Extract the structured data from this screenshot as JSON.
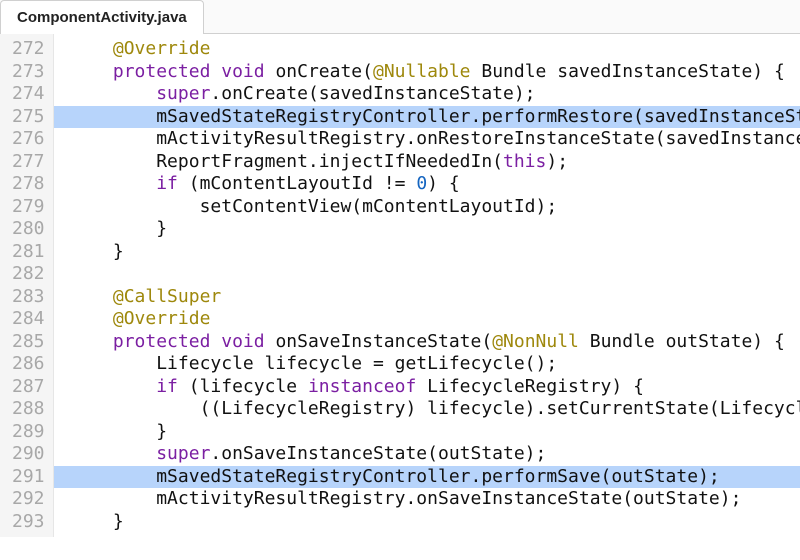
{
  "tab": {
    "title": "ComponentActivity.java"
  },
  "lines": [
    {
      "n": 272,
      "hl": false,
      "ind": 1,
      "tokens": [
        {
          "t": "@Override",
          "c": "ann"
        }
      ]
    },
    {
      "n": 273,
      "hl": false,
      "ind": 1,
      "tokens": [
        {
          "t": "protected ",
          "c": "kw"
        },
        {
          "t": "void ",
          "c": "kw"
        },
        {
          "t": "onCreate(",
          "c": "plain"
        },
        {
          "t": "@Nullable",
          "c": "ann"
        },
        {
          "t": " Bundle savedInstanceState) {",
          "c": "plain"
        }
      ]
    },
    {
      "n": 274,
      "hl": false,
      "ind": 2,
      "tokens": [
        {
          "t": "super",
          "c": "kw"
        },
        {
          "t": ".onCreate(savedInstanceState);",
          "c": "plain"
        }
      ]
    },
    {
      "n": 275,
      "hl": true,
      "ind": 2,
      "tokens": [
        {
          "t": "mSavedStateRegistryController.performRestore(savedInstanceState);",
          "c": "plain"
        }
      ]
    },
    {
      "n": 276,
      "hl": false,
      "ind": 2,
      "tokens": [
        {
          "t": "mActivityResultRegistry.onRestoreInstanceState(savedInstanceState);",
          "c": "plain"
        }
      ]
    },
    {
      "n": 277,
      "hl": false,
      "ind": 2,
      "tokens": [
        {
          "t": "ReportFragment.injectIfNeededIn(",
          "c": "plain"
        },
        {
          "t": "this",
          "c": "this"
        },
        {
          "t": ");",
          "c": "plain"
        }
      ]
    },
    {
      "n": 278,
      "hl": false,
      "ind": 2,
      "tokens": [
        {
          "t": "if",
          "c": "kw"
        },
        {
          "t": " (mContentLayoutId != ",
          "c": "plain"
        },
        {
          "t": "0",
          "c": "num"
        },
        {
          "t": ") {",
          "c": "plain"
        }
      ]
    },
    {
      "n": 279,
      "hl": false,
      "ind": 3,
      "tokens": [
        {
          "t": "setContentView(mContentLayoutId);",
          "c": "plain"
        }
      ]
    },
    {
      "n": 280,
      "hl": false,
      "ind": 2,
      "tokens": [
        {
          "t": "}",
          "c": "plain"
        }
      ]
    },
    {
      "n": 281,
      "hl": false,
      "ind": 1,
      "tokens": [
        {
          "t": "}",
          "c": "plain"
        }
      ]
    },
    {
      "n": 282,
      "hl": false,
      "ind": 0,
      "tokens": []
    },
    {
      "n": 283,
      "hl": false,
      "ind": 1,
      "tokens": [
        {
          "t": "@CallSuper",
          "c": "ann"
        }
      ]
    },
    {
      "n": 284,
      "hl": false,
      "ind": 1,
      "tokens": [
        {
          "t": "@Override",
          "c": "ann"
        }
      ]
    },
    {
      "n": 285,
      "hl": false,
      "ind": 1,
      "tokens": [
        {
          "t": "protected ",
          "c": "kw"
        },
        {
          "t": "void ",
          "c": "kw"
        },
        {
          "t": "onSaveInstanceState(",
          "c": "plain"
        },
        {
          "t": "@NonNull",
          "c": "ann"
        },
        {
          "t": " Bundle outState) {",
          "c": "plain"
        }
      ]
    },
    {
      "n": 286,
      "hl": false,
      "ind": 2,
      "tokens": [
        {
          "t": "Lifecycle lifecycle = getLifecycle();",
          "c": "plain"
        }
      ]
    },
    {
      "n": 287,
      "hl": false,
      "ind": 2,
      "tokens": [
        {
          "t": "if",
          "c": "kw"
        },
        {
          "t": " (lifecycle ",
          "c": "plain"
        },
        {
          "t": "instanceof",
          "c": "kw"
        },
        {
          "t": " LifecycleRegistry) {",
          "c": "plain"
        }
      ]
    },
    {
      "n": 288,
      "hl": false,
      "ind": 3,
      "tokens": [
        {
          "t": "((LifecycleRegistry) lifecycle).setCurrentState(Lifecycle.State.CREATED);",
          "c": "plain"
        }
      ]
    },
    {
      "n": 289,
      "hl": false,
      "ind": 2,
      "tokens": [
        {
          "t": "}",
          "c": "plain"
        }
      ]
    },
    {
      "n": 290,
      "hl": false,
      "ind": 2,
      "tokens": [
        {
          "t": "super",
          "c": "kw"
        },
        {
          "t": ".onSaveInstanceState(outState);",
          "c": "plain"
        }
      ]
    },
    {
      "n": 291,
      "hl": true,
      "ind": 2,
      "tokens": [
        {
          "t": "mSavedStateRegistryController.performSave(outState);",
          "c": "plain"
        }
      ]
    },
    {
      "n": 292,
      "hl": false,
      "ind": 2,
      "tokens": [
        {
          "t": "mActivityResultRegistry.onSaveInstanceState(outState);",
          "c": "plain"
        }
      ]
    },
    {
      "n": 293,
      "hl": false,
      "ind": 1,
      "tokens": [
        {
          "t": "}",
          "c": "plain"
        }
      ]
    }
  ],
  "indent_unit": "    "
}
